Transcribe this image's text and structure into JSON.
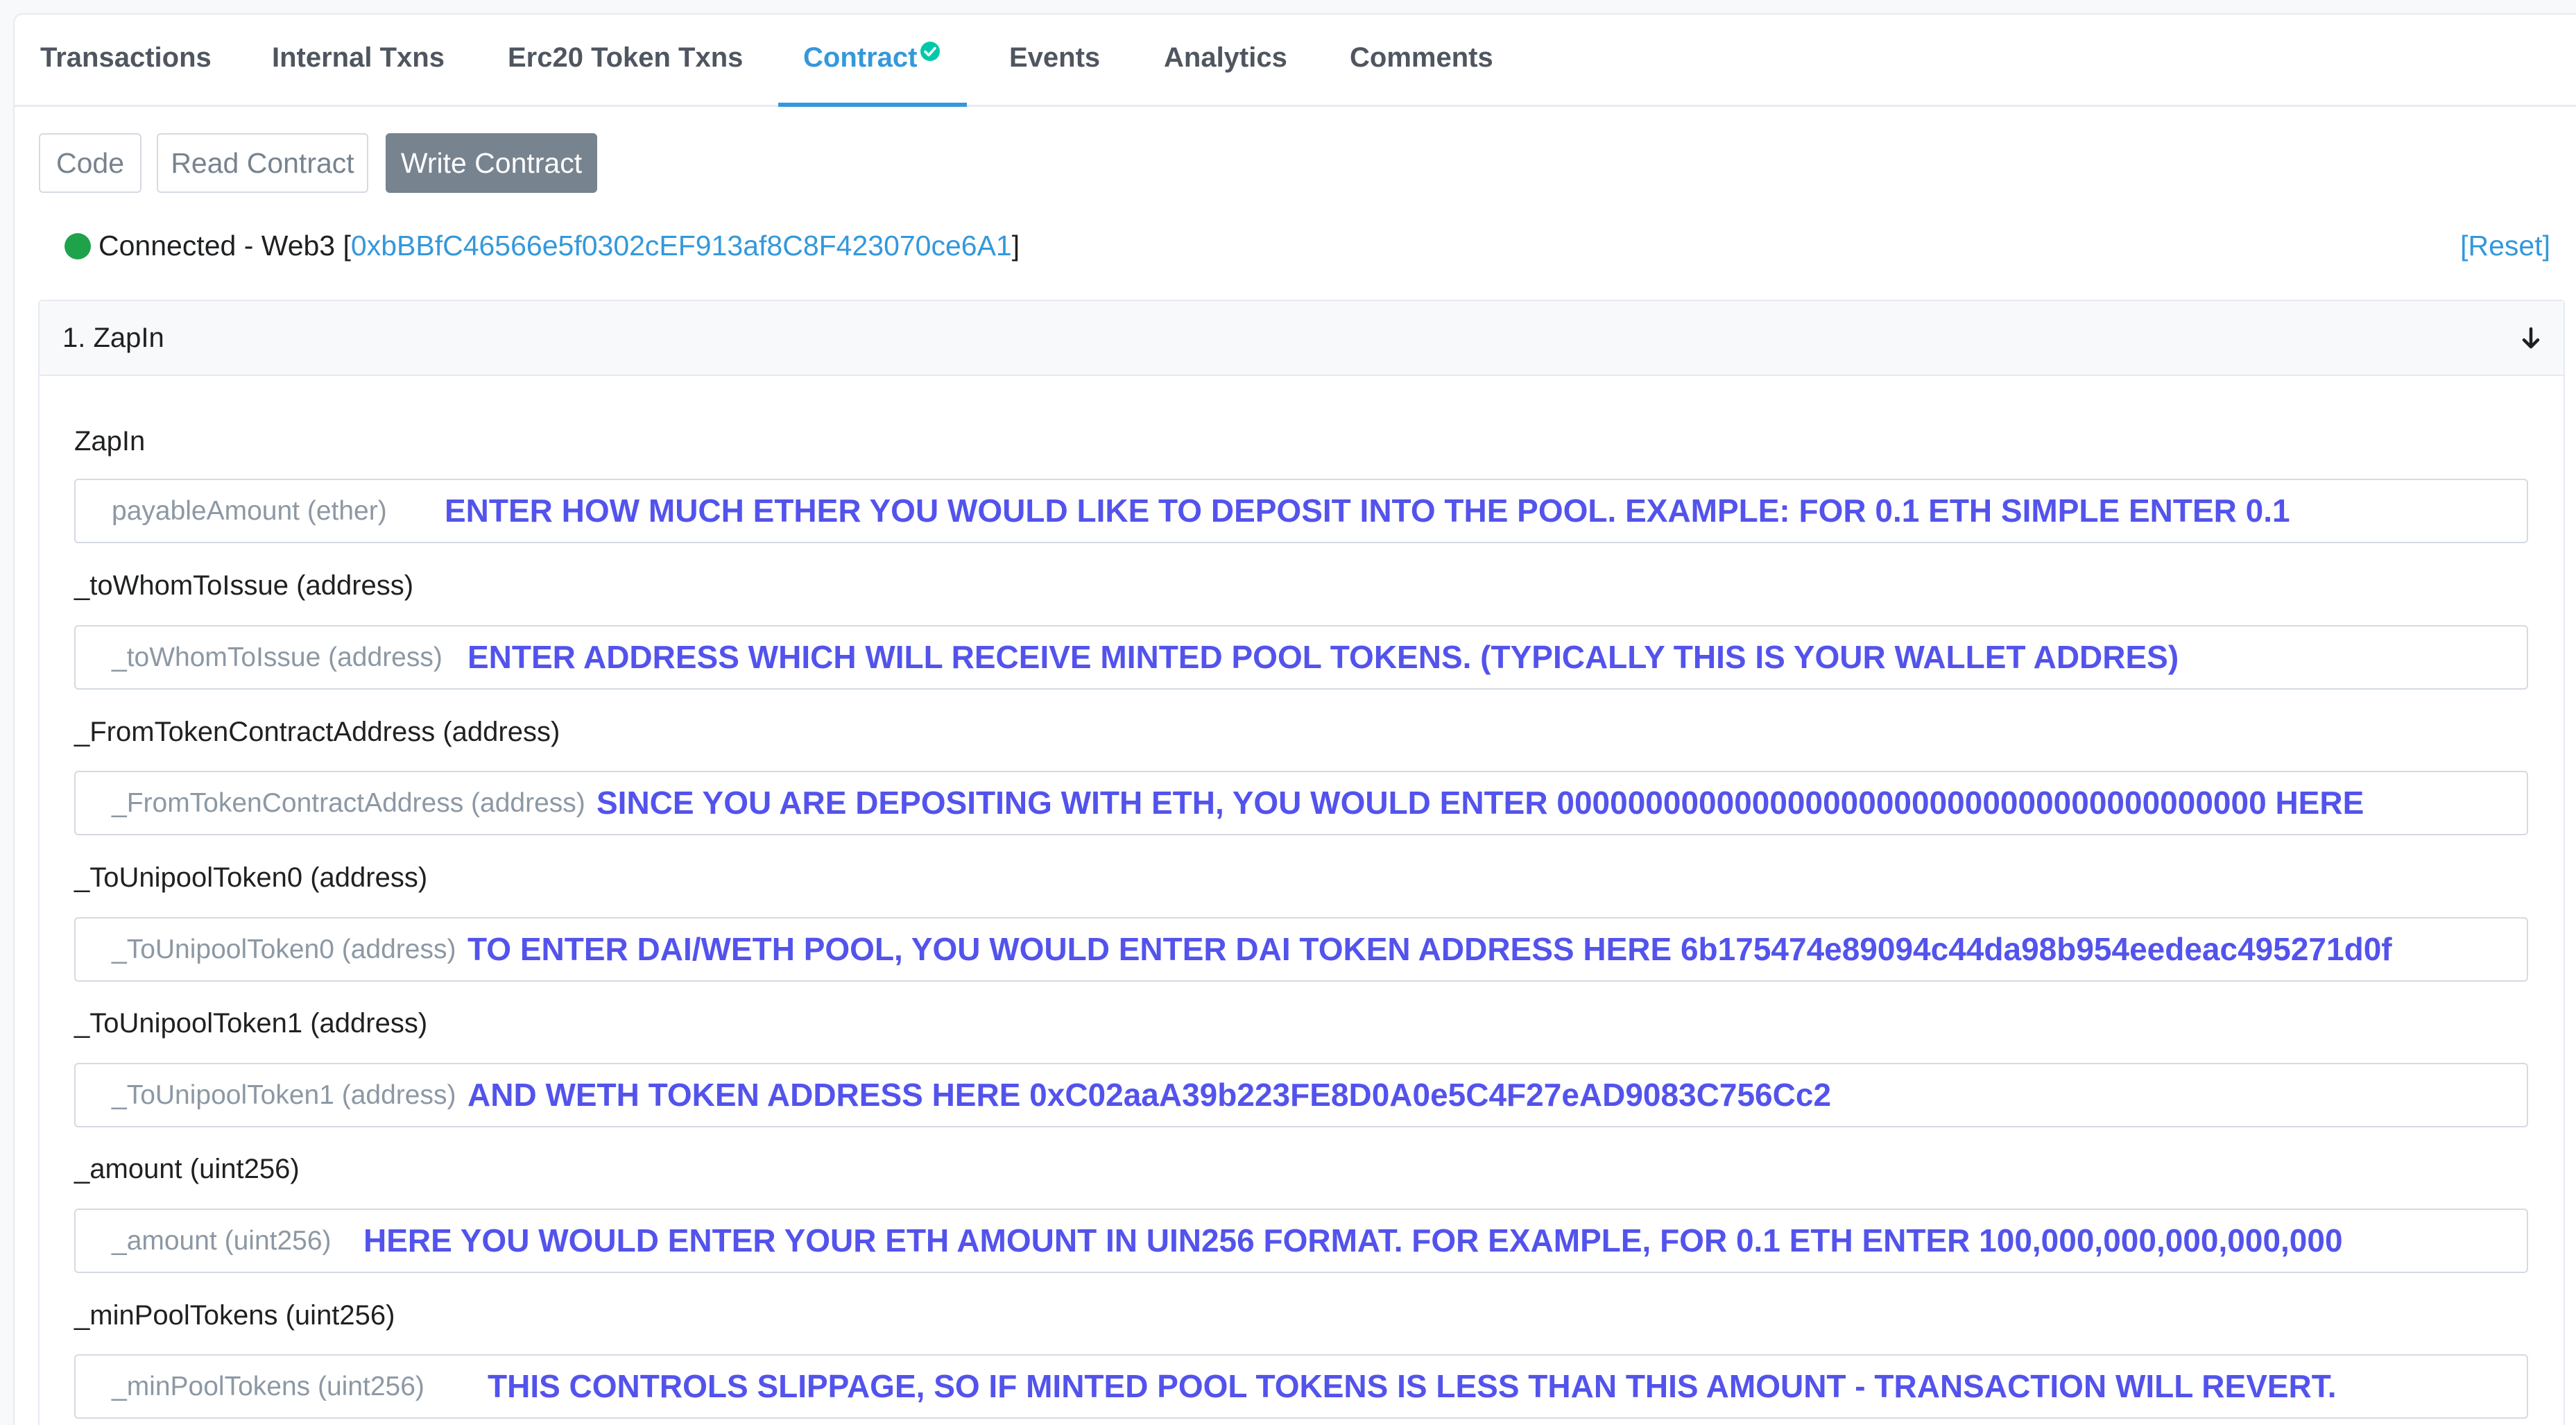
{
  "tabs": [
    {
      "label": "Transactions"
    },
    {
      "label": "Internal Txns"
    },
    {
      "label": "Erc20 Token Txns"
    },
    {
      "label": "Contract"
    },
    {
      "label": "Events"
    },
    {
      "label": "Analytics"
    },
    {
      "label": "Comments"
    }
  ],
  "active_tab": "Contract",
  "subtabs": [
    {
      "label": "Code"
    },
    {
      "label": "Read Contract"
    },
    {
      "label": "Write Contract"
    }
  ],
  "active_subtab": "Write Contract",
  "connection": {
    "status_text": "Connected - Web3 [",
    "address": "0xbBBfC46566e5f0302cEF913af8C8F423070ce6A1",
    "close_bracket": "]",
    "reset_label": "[Reset]",
    "status_color": "#1ea34a"
  },
  "function": {
    "title": "1. ZapIn",
    "name": "ZapIn",
    "params": [
      {
        "label": "",
        "placeholder": "payableAmount (ether)",
        "note": "ENTER HOW MUCH ETHER YOU WOULD LIKE TO DEPOSIT INTO THE POOL. EXAMPLE: FOR 0.1 ETH SIMPLE ENTER 0.1"
      },
      {
        "label": "_toWhomToIssue (address)",
        "placeholder": "_toWhomToIssue (address)",
        "note": "ENTER ADDRESS WHICH WILL RECEIVE MINTED POOL TOKENS. (TYPICALLY THIS IS YOUR WALLET ADDRES)"
      },
      {
        "label": "_FromTokenContractAddress (address)",
        "placeholder": "_FromTokenContractAddress (address)",
        "note": "SINCE YOU ARE DEPOSITING WITH ETH, YOU WOULD ENTER 0000000000000000000000000000000000000000 HERE"
      },
      {
        "label": "_ToUnipoolToken0 (address)",
        "placeholder": "_ToUnipoolToken0 (address)",
        "note": "TO ENTER DAI/WETH POOL, YOU WOULD ENTER DAI TOKEN ADDRESS HERE 6b175474e89094c44da98b954eedeac495271d0f"
      },
      {
        "label": "_ToUnipoolToken1 (address)",
        "placeholder": "_ToUnipoolToken1 (address)",
        "note": "AND WETH TOKEN ADDRESS HERE 0xC02aaA39b223FE8D0A0e5C4F27eAD9083C756Cc2"
      },
      {
        "label": "_amount (uint256)",
        "placeholder": "_amount (uint256)",
        "note": "HERE YOU WOULD ENTER YOUR ETH AMOUNT IN UIN256 FORMAT. FOR EXAMPLE, FOR 0.1 ETH ENTER 100,000,000,000,000,000"
      },
      {
        "label": "_minPoolTokens (uint256)",
        "placeholder": "_minPoolTokens (uint256)",
        "note": "THIS CONTROLS SLIPPAGE, SO IF MINTED POOL TOKENS IS LESS THAN THIS AMOUNT - TRANSACTION WILL REVERT."
      }
    ]
  },
  "colors": {
    "accent": "#3498db",
    "annotation": "#5353ec",
    "verified": "#00c9a7"
  },
  "icons": {
    "verified": "verified-check-icon",
    "collapse": "arrow-down-icon",
    "status": "status-dot-icon"
  }
}
